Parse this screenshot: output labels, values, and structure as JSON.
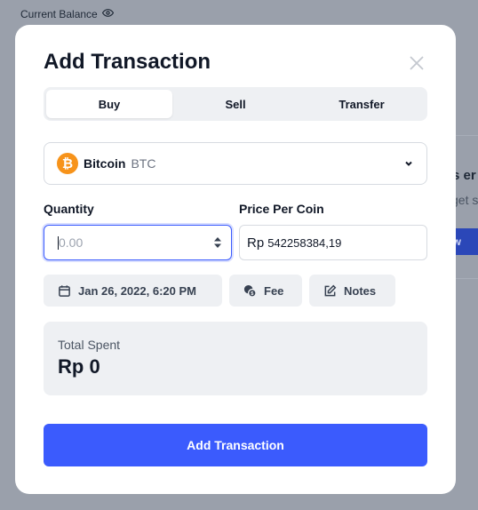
{
  "background": {
    "balance_label": "Current Balance",
    "card_title_fragment": "s er",
    "card_text_fragment": "get s",
    "card_button_fragment": "ew"
  },
  "modal": {
    "title": "Add Transaction",
    "tabs": [
      {
        "label": "Buy",
        "active": true
      },
      {
        "label": "Sell",
        "active": false
      },
      {
        "label": "Transfer",
        "active": false
      }
    ],
    "coin": {
      "name": "Bitcoin",
      "symbol": "BTC",
      "icon_glyph": "₿",
      "icon_color": "#f7931a"
    },
    "quantity": {
      "label": "Quantity",
      "placeholder": "0.00",
      "value": ""
    },
    "price": {
      "label": "Price Per Coin",
      "currency": "Rp",
      "value": "542258384,19"
    },
    "chips": {
      "date": "Jan 26, 2022, 6:20 PM",
      "fee": "Fee",
      "notes": "Notes"
    },
    "total": {
      "label": "Total Spent",
      "value": "Rp 0"
    },
    "submit_label": "Add Transaction"
  },
  "colors": {
    "accent": "#3b5bfd",
    "overlay": "#9aa0ab",
    "bitcoin": "#f7931a"
  }
}
